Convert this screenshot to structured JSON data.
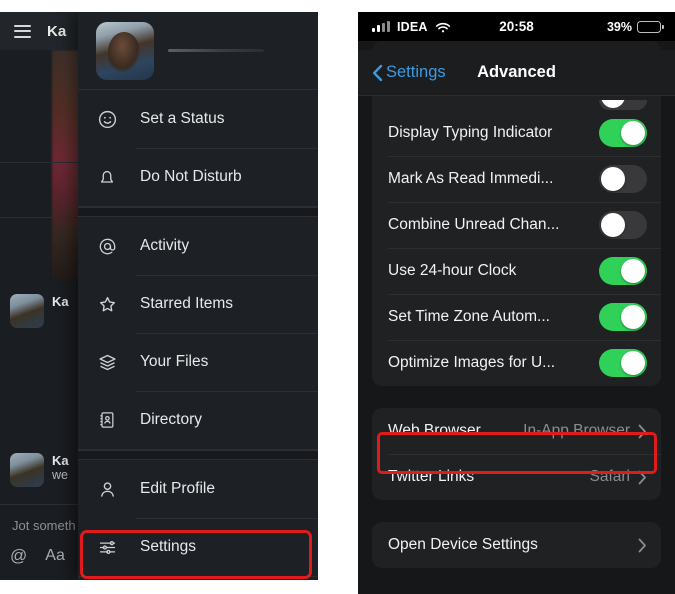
{
  "left_panel": {
    "chat": {
      "hamburger_icon": "hamburger-menu-icon",
      "title": "Ka",
      "messages": [
        {
          "name": "Ka",
          "text": ""
        },
        {
          "name": "Ka",
          "text": "we"
        }
      ],
      "composer_placeholder": "Jot someth",
      "composer_icons": [
        "mention-icon",
        "text-format-icon"
      ],
      "composer_icon_labels": {
        "mention": "@",
        "format": "Aa"
      }
    },
    "menu": {
      "avatar": "user-avatar",
      "groups": [
        {
          "items": [
            {
              "icon": "smiley-icon",
              "label": "Set a Status"
            },
            {
              "icon": "bell-icon",
              "label": "Do Not Disturb"
            }
          ]
        },
        {
          "items": [
            {
              "icon": "mention-icon",
              "label": "Activity"
            },
            {
              "icon": "star-icon",
              "label": "Starred Items"
            },
            {
              "icon": "layers-icon",
              "label": "Your Files"
            },
            {
              "icon": "contact-book-icon",
              "label": "Directory"
            }
          ]
        },
        {
          "items": [
            {
              "icon": "person-icon",
              "label": "Edit Profile"
            },
            {
              "icon": "sliders-icon",
              "label": "Settings"
            }
          ]
        }
      ],
      "highlight": {
        "target": "Settings",
        "color": "#e01b1b"
      }
    }
  },
  "right_panel": {
    "status_bar": {
      "signal_icon": "cellular-signal-icon",
      "carrier": "IDEA",
      "wifi_icon": "wifi-icon",
      "time": "20:58",
      "battery_percent": "39%",
      "battery_icon": "battery-icon",
      "battery_level": 39,
      "battery_color": "#f6d40b"
    },
    "nav_bar": {
      "back_icon": "chevron-left-icon",
      "back_label": "Settings",
      "title": "Advanced"
    },
    "sections": [
      {
        "id": "toggles",
        "partial_top_row": true,
        "rows": [
          {
            "label": "Display Typing Indicator",
            "control": "toggle",
            "on": true
          },
          {
            "label": "Mark As Read Immedi...",
            "control": "toggle",
            "on": false
          },
          {
            "label": "Combine Unread Chan...",
            "control": "toggle",
            "on": false
          },
          {
            "label": "Use 24-hour Clock",
            "control": "toggle",
            "on": true
          },
          {
            "label": "Set Time Zone Autom...",
            "control": "toggle",
            "on": true
          },
          {
            "label": "Optimize Images for U...",
            "control": "toggle",
            "on": true
          }
        ]
      },
      {
        "id": "browser",
        "partial_top_row": false,
        "rows": [
          {
            "label": "Web Browser",
            "control": "value",
            "value": "In-App Browser"
          },
          {
            "label": "Twitter Links",
            "control": "value",
            "value": "Safari"
          }
        ]
      },
      {
        "id": "device",
        "partial_top_row": false,
        "rows": [
          {
            "label": "Open Device Settings",
            "control": "chevron",
            "value": ""
          }
        ]
      }
    ],
    "highlight": {
      "target": "Optimize Images for U...",
      "color": "#e01b1b"
    }
  }
}
